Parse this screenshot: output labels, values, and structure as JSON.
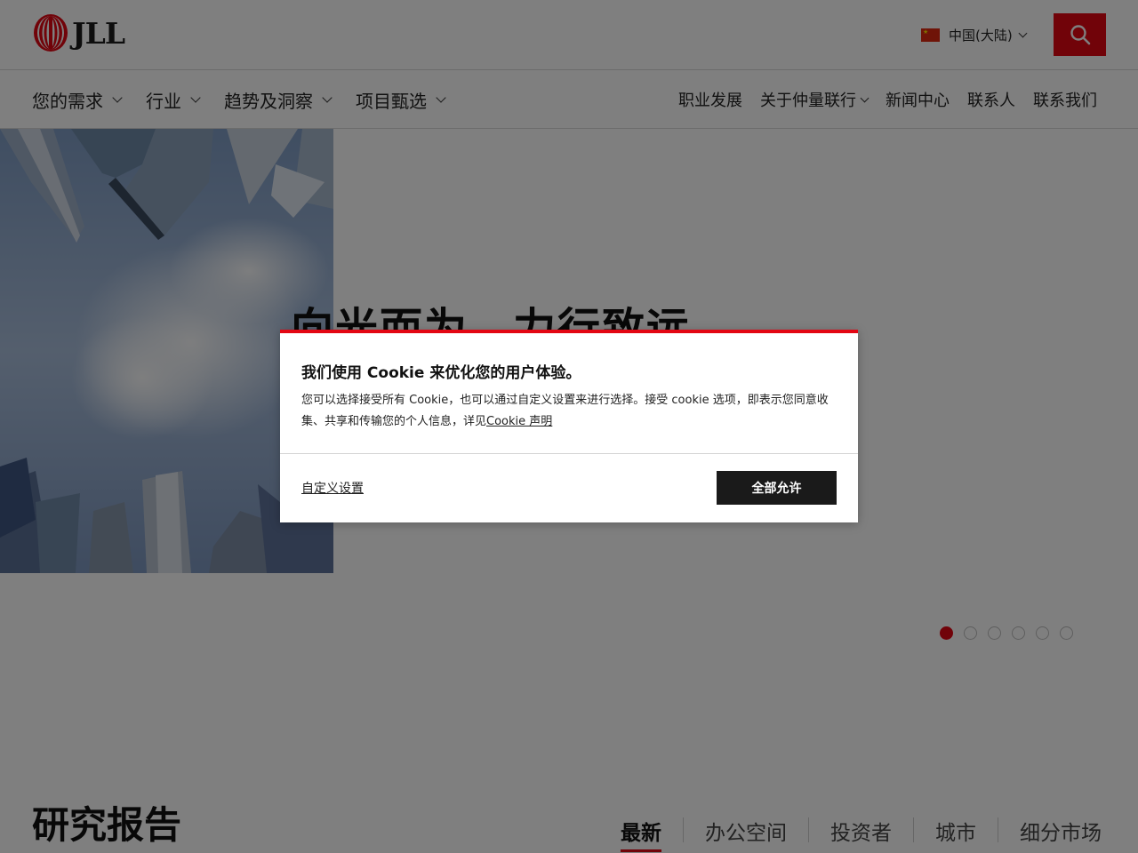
{
  "header": {
    "logo_text": "JLL",
    "region_label": "中国(大陆)",
    "search_icon": "search-icon",
    "accent_color": "#e30613"
  },
  "nav": {
    "left_items": [
      {
        "label": "您的需求",
        "has_dropdown": true
      },
      {
        "label": "行业",
        "has_dropdown": true
      },
      {
        "label": "趋势及洞察",
        "has_dropdown": true
      },
      {
        "label": "项目甄选",
        "has_dropdown": true
      }
    ],
    "right_items": [
      {
        "label": "职业发展",
        "has_dropdown": false
      },
      {
        "label": "关于仲量联行",
        "has_dropdown": true
      },
      {
        "label": "新闻中心",
        "has_dropdown": false
      },
      {
        "label": "联系人",
        "has_dropdown": false
      },
      {
        "label": "联系我们",
        "has_dropdown": false
      }
    ]
  },
  "hero": {
    "title": "向光而为，力行致远",
    "slides_total": 6,
    "active_slide": 1
  },
  "research": {
    "title": "研究报告",
    "tabs": [
      {
        "label": "最新",
        "active": true
      },
      {
        "label": "办公空间",
        "active": false
      },
      {
        "label": "投资者",
        "active": false
      },
      {
        "label": "城市",
        "active": false
      },
      {
        "label": "细分市场",
        "active": false
      }
    ]
  },
  "cookie": {
    "title": "我们使用 Cookie 来优化您的用户体验。",
    "body": "您可以选择接受所有 Cookie，也可以通过自定义设置来进行选择。接受 cookie 选项，即表示您同意收集、共享和传输您的个人信息，详见",
    "link_label": "Cookie 声明",
    "customize_label": "自定义设置",
    "accept_label": "全部允许"
  }
}
